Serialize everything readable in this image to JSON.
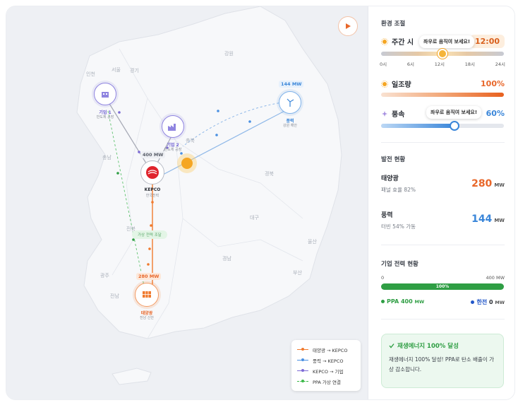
{
  "map": {
    "regions": [
      "강원",
      "서울",
      "경기",
      "인천",
      "충북",
      "충남",
      "경북",
      "대구",
      "전북",
      "울산",
      "광주",
      "전남",
      "경남",
      "부산"
    ],
    "play_button": "play-icon",
    "nodes": {
      "company1": {
        "title": "기업 1",
        "sub": "반도체 공장"
      },
      "company2": {
        "title": "기업 2",
        "sub": "반도체 공장"
      },
      "wind": {
        "title": "풍력",
        "sub": "강원 해안",
        "badge": "144 MW"
      },
      "kepco": {
        "title": "KEPCO",
        "sub": "한국전력",
        "badge": "400 MW"
      },
      "solar": {
        "title": "태양광",
        "sub": "전남 신안",
        "badge": "280 MW"
      },
      "ppa_label": "가상 전력 조달"
    },
    "legend": [
      {
        "label": "태양광 → KEPCO",
        "color": "#f07a2e"
      },
      {
        "label": "풍력 → KEPCO",
        "color": "#4a90e2"
      },
      {
        "label": "KEPCO → 기업",
        "color": "#7d6bd6"
      },
      {
        "label": "PPA 가상 연결",
        "color": "#3cb94a"
      }
    ]
  },
  "panel": {
    "env_title": "환경 조절",
    "daytime": {
      "label": "주간 시간",
      "label_visible": "주간 시",
      "value": "12:00",
      "tooltip": "좌우로 움직여 보세요!",
      "ticks": [
        "0시",
        "6시",
        "12시",
        "18시",
        "24시"
      ],
      "level": 0.5
    },
    "sunlight": {
      "label": "일조량",
      "value": "100%",
      "level": 1.0
    },
    "wind": {
      "label": "풍속",
      "value": "60%",
      "tooltip": "좌우로 움직여 보세요!",
      "level": 0.6
    },
    "gen_title": "발전 현황",
    "solar": {
      "name": "태양광",
      "desc": "패널 효율 82%",
      "value": "280",
      "unit": "MW"
    },
    "windgen": {
      "name": "풍력",
      "desc": "터빈 54% 가동",
      "value": "144",
      "unit": "MW"
    },
    "corp_title": "기업 전력 현황",
    "corp": {
      "min": "0",
      "max": "400 MW",
      "bar_label": "100%",
      "level": 1.0,
      "ppa_label": "PPA",
      "ppa_value": "400",
      "ppa_unit": "MW",
      "kepco_label": "한전",
      "kepco_value": "0",
      "kepco_unit": "MW"
    },
    "alert": {
      "title": "재생에너지 100% 달성",
      "body": "재생에너지 100% 달성! PPA로 탄소 배출이 가상 감소합니다."
    }
  },
  "colors": {
    "solar": "#f07a2e",
    "wind": "#3a86d9",
    "kepco": "#7d6bd6",
    "ppa": "#2f9e44",
    "sun": "#f5a623"
  }
}
